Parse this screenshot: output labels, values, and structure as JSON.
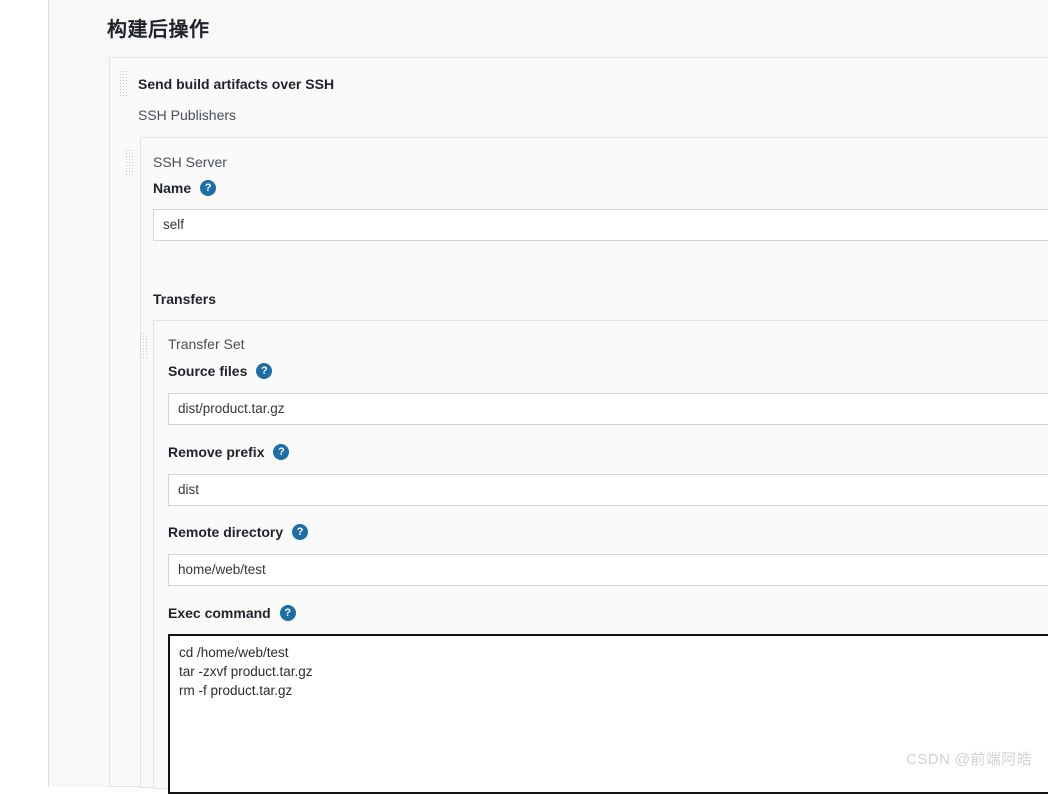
{
  "window": {
    "tabstrip": {
      "active_tab_label": "",
      "tabs": [
        {
          "label": "",
          "active": false
        },
        {
          "label": "",
          "active": true
        },
        {
          "label": "",
          "active": false
        }
      ]
    }
  },
  "page": {
    "title": "构建后操作"
  },
  "post_build_action": {
    "name": "Send build artifacts over SSH",
    "publishers_label": "SSH Publishers",
    "drag_handle_icon": "drag-handle-dots-icon"
  },
  "ssh_server": {
    "title": "SSH Server",
    "drag_handle_icon": "drag-handle-dots-icon",
    "name_field": {
      "label": "Name",
      "help_icon": "help-question-icon",
      "value": "self",
      "placeholder": ""
    }
  },
  "transfers": {
    "title": "Transfers",
    "transfer_set": {
      "title": "Transfer Set",
      "drag_handle_icon": "drag-handle-dots-icon",
      "source_files": {
        "label": "Source files",
        "help_icon": "help-question-icon",
        "value": "dist/product.tar.gz",
        "placeholder": ""
      },
      "remove_prefix": {
        "label": "Remove prefix",
        "help_icon": "help-question-icon",
        "value": "dist",
        "placeholder": ""
      },
      "remote_directory": {
        "label": "Remote directory",
        "help_icon": "help-question-icon",
        "value": "home/web/test",
        "placeholder": ""
      },
      "exec_command": {
        "label": "Exec command",
        "help_icon": "help-question-icon",
        "value": "cd /home/web/test\ntar -zxvf product.tar.gz\nrm -f product.tar.gz",
        "placeholder": ""
      }
    }
  },
  "watermark": {
    "text": "CSDN @前端阿皓"
  },
  "colors": {
    "accent_blue": "#1c6ea4",
    "page_bg": "#ffffff",
    "panel_bg": "#fafafa",
    "tabstrip_bg": "#dee4e9",
    "border_gray": "#e4e4e4",
    "input_border": "#d4d4d4",
    "focus_border": "#121212",
    "text_primary": "#1f2329",
    "watermark_gray": "#d2d2d2"
  }
}
